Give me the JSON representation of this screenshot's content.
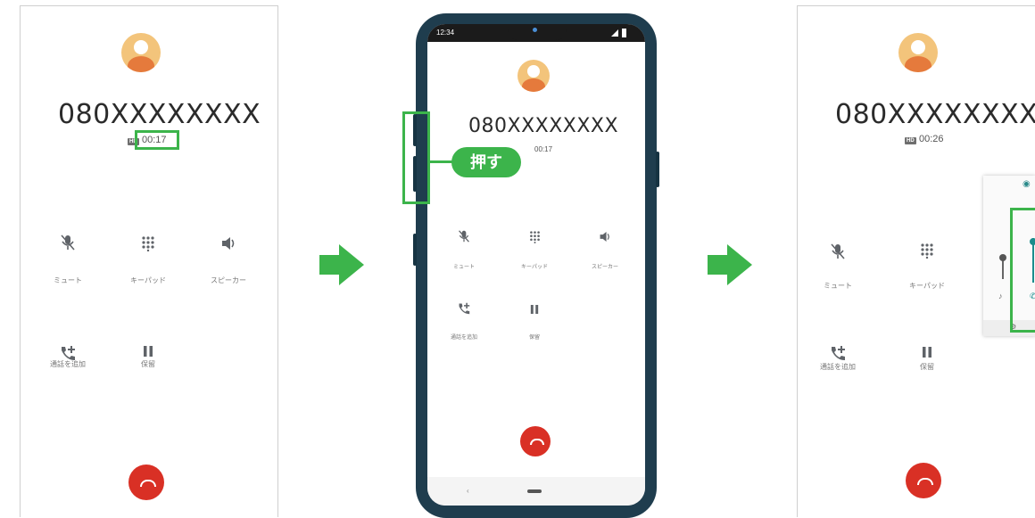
{
  "left_screen": {
    "phone_number": "080XXXXXXXX",
    "call_timer": "00:17",
    "hd_badge": "HD",
    "buttons": {
      "mute": "ミュート",
      "keypad": "キーパッド",
      "speaker": "スピーカー",
      "add_call": "通話を追加",
      "hold": "保留"
    }
  },
  "middle_screen": {
    "status_time": "12:34",
    "phone_number": "080XXXXXXXX",
    "call_timer": "00:17",
    "press_label": "押す",
    "buttons": {
      "mute": "ミュート",
      "keypad": "キーパッド",
      "speaker": "スピーカー",
      "add_call": "通話を追加",
      "hold": "保留"
    }
  },
  "right_screen": {
    "phone_number": "080XXXXXXXX",
    "call_timer": "00:26",
    "hd_badge": "HD",
    "buttons": {
      "mute": "ミュート",
      "keypad": "キーパッド",
      "add_call": "通話を追加",
      "hold": "保留"
    }
  },
  "colors": {
    "highlight": "#3cb44b",
    "end_call": "#d93025",
    "avatar_bg": "#f3c47b",
    "avatar_fg": "#e57a3c",
    "phone_body": "#1f3d4e"
  }
}
